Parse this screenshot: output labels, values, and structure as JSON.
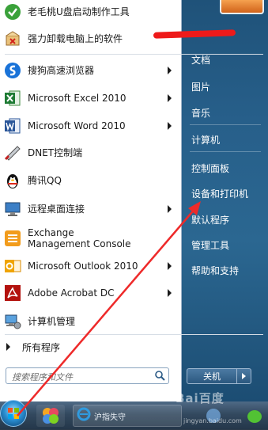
{
  "left_items": [
    {
      "label": "老毛桃U盘启动制作工具",
      "icon": "laomaotao-icon",
      "arrow": false
    },
    {
      "label": "强力卸载电脑上的软件",
      "icon": "uninstall-icon",
      "arrow": false
    },
    {
      "label": "搜狗高速浏览器",
      "icon": "sogou-browser-icon",
      "arrow": true
    },
    {
      "label": "Microsoft Excel 2010",
      "icon": "excel-icon",
      "arrow": true
    },
    {
      "label": "Microsoft Word 2010",
      "icon": "word-icon",
      "arrow": true
    },
    {
      "label": "DNET控制端",
      "icon": "dnet-icon",
      "arrow": false
    },
    {
      "label": "腾讯QQ",
      "icon": "qq-icon",
      "arrow": false
    },
    {
      "label": "远程桌面连接",
      "icon": "remote-desktop-icon",
      "arrow": true
    },
    {
      "label": "Exchange Management Console",
      "icon": "exchange-icon",
      "arrow": false
    },
    {
      "label": "Microsoft Outlook 2010",
      "icon": "outlook-icon",
      "arrow": true
    },
    {
      "label": "Adobe Acrobat DC",
      "icon": "acrobat-icon",
      "arrow": true
    },
    {
      "label": "计算机管理",
      "icon": "computer-management-icon",
      "arrow": false
    }
  ],
  "all_programs": "所有程序",
  "search_placeholder": "搜索程序和文件",
  "right_items": [
    {
      "label": "文档"
    },
    {
      "label": "图片"
    },
    {
      "label": "音乐"
    },
    {
      "label": "计算机"
    },
    {
      "label": "控制面板"
    },
    {
      "label": "设备和打印机"
    },
    {
      "label": "默认程序"
    },
    {
      "label": "管理工具"
    },
    {
      "label": "帮助和支持"
    }
  ],
  "shutdown_label": "关机",
  "taskbar": {
    "ie_label": "沪指失守"
  },
  "watermark": {
    "brand": "Bai百度",
    "site": "jingyan.baidu.com"
  },
  "colors": {
    "annotation": "#ee1a1a",
    "right_panel": "#275f8a",
    "taskbar": "#33495f"
  }
}
